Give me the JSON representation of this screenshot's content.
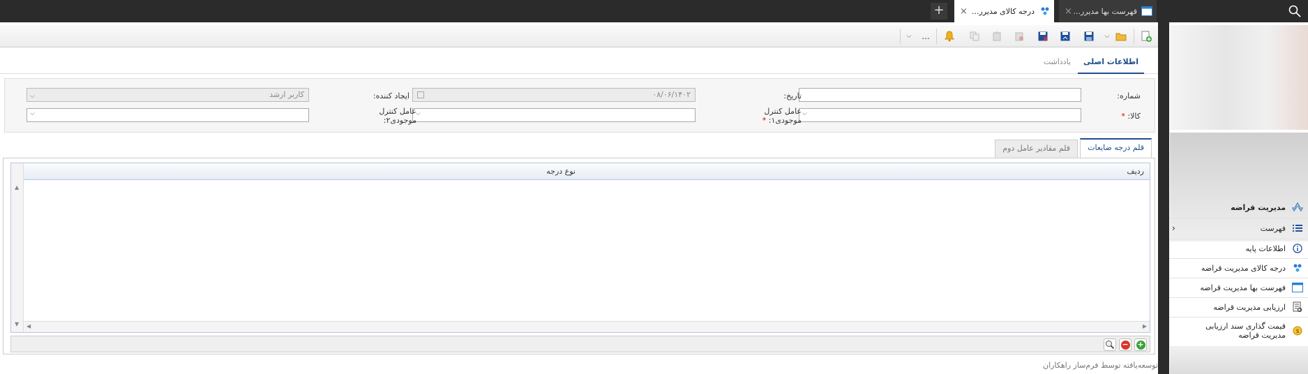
{
  "tabs": [
    {
      "label": "قهرست بها مدیرر...",
      "active": false
    },
    {
      "label": "درجه کالای مدیرر...",
      "active": true
    }
  ],
  "new_tab_symbol": "+",
  "close_symbol": "×",
  "toolbar": {
    "more_label": "...",
    "icons": [
      "add-icon",
      "open-folder-icon",
      "save-icon",
      "save-as-icon",
      "save-close-icon",
      "delete-icon",
      "paste-icon",
      "copy-icon",
      "bell-icon"
    ]
  },
  "form_tabs": [
    {
      "label": "اطلاعات اصلی",
      "active": true
    },
    {
      "label": "یادداشت",
      "active": false
    }
  ],
  "form": {
    "number_label": "شماره:",
    "number_value": "",
    "date_label": "تاریخ:",
    "date_value": "۰۸/۰۶/۱۴۰۲",
    "creator_label": "ایجاد کننده:",
    "creator_value": "کاربر ارشد",
    "item_label": "کالا:",
    "item_value": "",
    "factor1_label_line1": "عامل کنترل",
    "factor1_label_line2": "موجودی۱:",
    "factor1_value": "",
    "factor2_label_line1": "عامل کنترل",
    "factor2_label_line2": "موجودی۲:",
    "factor2_value": "",
    "required_mark": "*"
  },
  "sub_tabs": [
    {
      "label": "قلم درجه ضایعات",
      "active": true
    },
    {
      "label": "قلم مقادیر عامل دوم",
      "active": false
    }
  ],
  "grid": {
    "columns": [
      "ردیف",
      "نوع درجه"
    ],
    "rows": []
  },
  "footer_credit": "توسعه‌یافته توسط فرم‌ساز راهکاران",
  "sidebar": {
    "section_title": "مدیریت قراضه",
    "items": [
      {
        "label": "فهرست",
        "icon": "list-icon"
      },
      {
        "label": "اطلاعات پایه",
        "icon": "info-icon"
      },
      {
        "label": "درجه کالای مدیریت قراضه",
        "icon": "grade-icon"
      },
      {
        "label": "فهرست بها مدیریت قراضه",
        "icon": "pricelist-icon"
      },
      {
        "label": "ارزیابی مدیریت قراضه",
        "icon": "evaluation-icon"
      },
      {
        "label": "قیمت گذاری سند ارزیابی مدیریت قراضه",
        "icon": "pricing-icon"
      }
    ]
  },
  "colors": {
    "accent": "#1d4e89",
    "dark_chrome": "#2b2b2b",
    "required": "#dd0000"
  }
}
